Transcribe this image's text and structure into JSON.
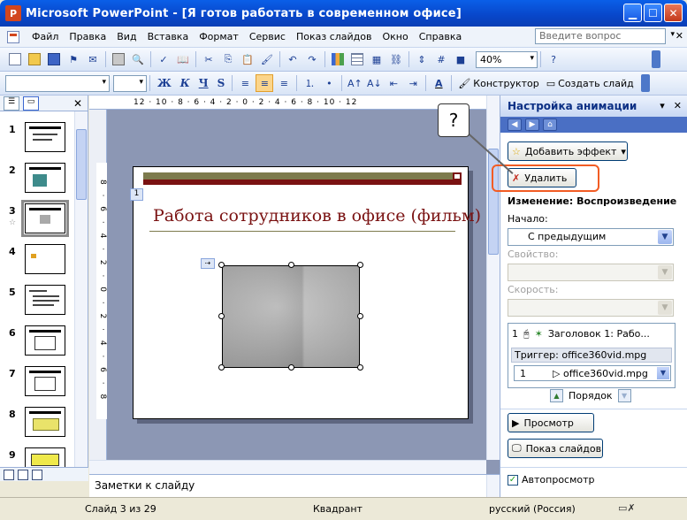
{
  "window": {
    "title": "Microsoft PowerPoint - [Я готов работать в современном офисе]",
    "app_icon_letter": "P"
  },
  "menu": {
    "items": [
      "Файл",
      "Правка",
      "Вид",
      "Вставка",
      "Формат",
      "Сервис",
      "Показ слайдов",
      "Окно",
      "Справка"
    ],
    "help_placeholder": "Введите вопрос"
  },
  "toolbar": {
    "zoom": "40%",
    "format_buttons": [
      "Ж",
      "К",
      "Ч",
      "S"
    ],
    "designer_label": "Конструктор",
    "new_slide_label": "Создать слайд"
  },
  "slide_pane": {
    "slide_numbers": [
      "1",
      "2",
      "3",
      "4",
      "5",
      "6",
      "7",
      "8",
      "9"
    ],
    "selected_index": 2
  },
  "ruler": {
    "horizontal": "12 · 10 · 8 · 6 · 4 · 2 · 0 · 2 · 4 · 6 · 8 · 10 · 12",
    "vertical": "8 · 6 · 4 · 2 · 0 · 2 · 4 · 6 · 8"
  },
  "slide": {
    "anim_tag": "1",
    "title": "Работа сотрудников в офисе (фильм)"
  },
  "notes": {
    "placeholder": "Заметки к слайду"
  },
  "task_pane": {
    "title": "Настройка анимации",
    "add_effect": "Добавить эффект",
    "delete": "Удалить",
    "change_header": "Изменение: Воспроизведение",
    "start_label": "Начало:",
    "start_value": "С предыдущим",
    "property_label": "Свойство:",
    "speed_label": "Скорость:",
    "anim_item_num": "1",
    "anim_item_text": "Заголовок 1: Рабо...",
    "trigger_label": "Триггер: office360vid.mpg",
    "trigger_item_num": "1",
    "trigger_item_text": "office360vid.mpg",
    "order_label": "Порядок",
    "preview": "Просмотр",
    "slideshow": "Показ слайдов",
    "autopreview": "Автопросмотр"
  },
  "callout": {
    "symbol": "?"
  },
  "status": {
    "slide_info": "Слайд 3 из 29",
    "design": "Квадрант",
    "language": "русский (Россия)"
  },
  "colors": {
    "title_bar": "#0846C9",
    "slide_title": "#7A1212",
    "highlight": "#F25C24"
  }
}
